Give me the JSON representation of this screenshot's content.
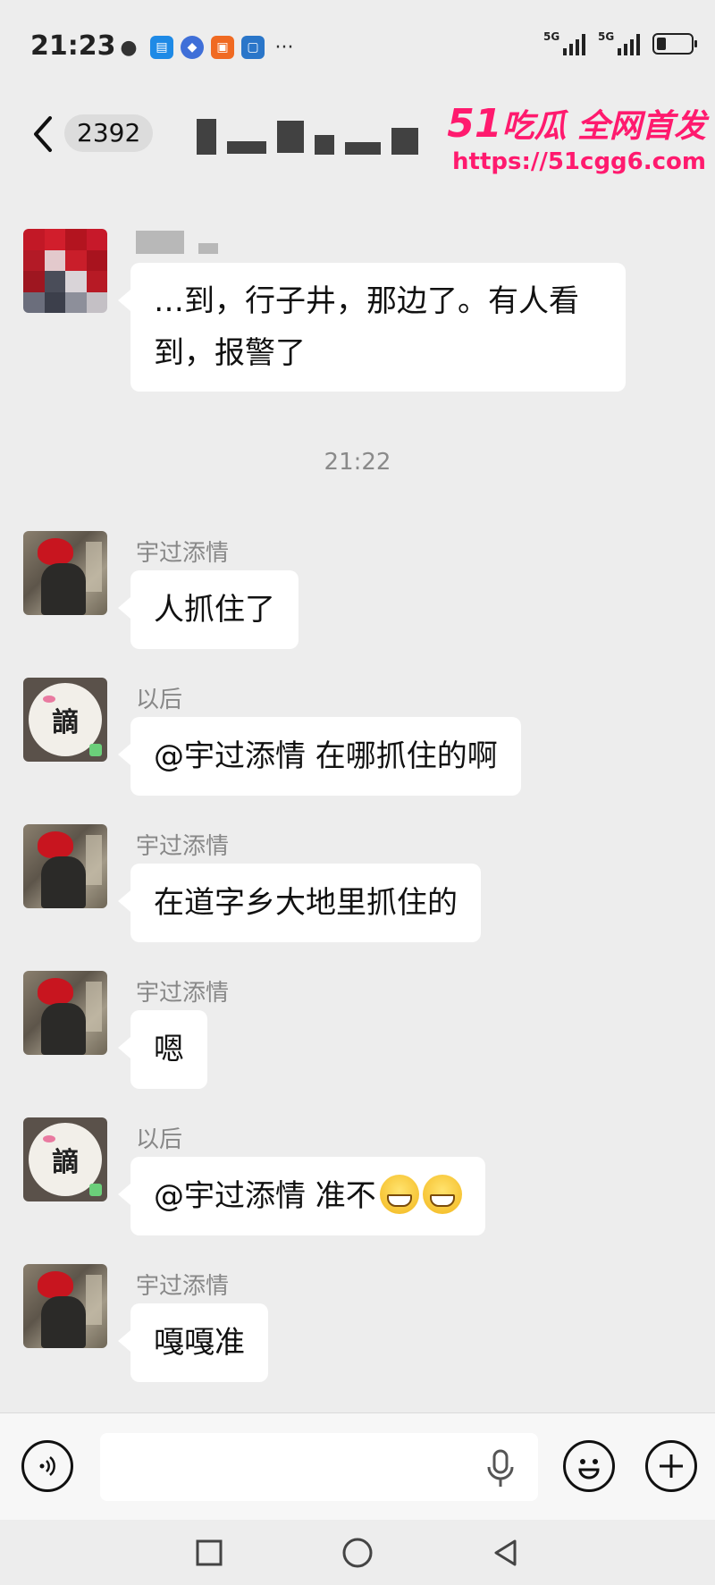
{
  "status_bar": {
    "time": "21:23",
    "app_icons": [
      "wechat-icon",
      "reader-icon",
      "compass-icon",
      "shop-icon",
      "app-icon"
    ],
    "more": "···",
    "network_1": "5G",
    "network_2": "5G"
  },
  "header": {
    "back_icon": "chevron-left-icon",
    "unread_count": "2392"
  },
  "watermark": {
    "logo_num": "51",
    "logo_text": "吃瓜 全网首发",
    "url": "https://51cgg6.com"
  },
  "messages": [
    {
      "sender": "",
      "text": "…到，行子井，那边了。有人看到，报警了",
      "avatar": "mosaic"
    },
    {
      "sender": "宇过添情",
      "text": "人抓住了",
      "avatar": "photo"
    },
    {
      "sender": "以后",
      "text": "@宇过添情  在哪抓住的啊",
      "avatar": "logo"
    },
    {
      "sender": "宇过添情",
      "text": "在道字乡大地里抓住的",
      "avatar": "photo"
    },
    {
      "sender": "宇过添情",
      "text": "嗯",
      "avatar": "photo"
    },
    {
      "sender": "以后",
      "text": "@宇过添情  准不",
      "avatar": "logo",
      "emojis": [
        "grin-emoji",
        "grin-emoji"
      ]
    },
    {
      "sender": "宇过添情",
      "text": "嘎嘎准",
      "avatar": "photo"
    }
  ],
  "timestamp": "21:22",
  "input_bar": {
    "placeholder": "",
    "voice_icon": "voice-icon",
    "mic_icon": "mic-icon",
    "emoji_icon": "smile-icon",
    "plus_icon": "plus-icon"
  },
  "nav": {
    "square": "recent-apps-icon",
    "circle": "home-icon",
    "triangle": "back-icon"
  }
}
